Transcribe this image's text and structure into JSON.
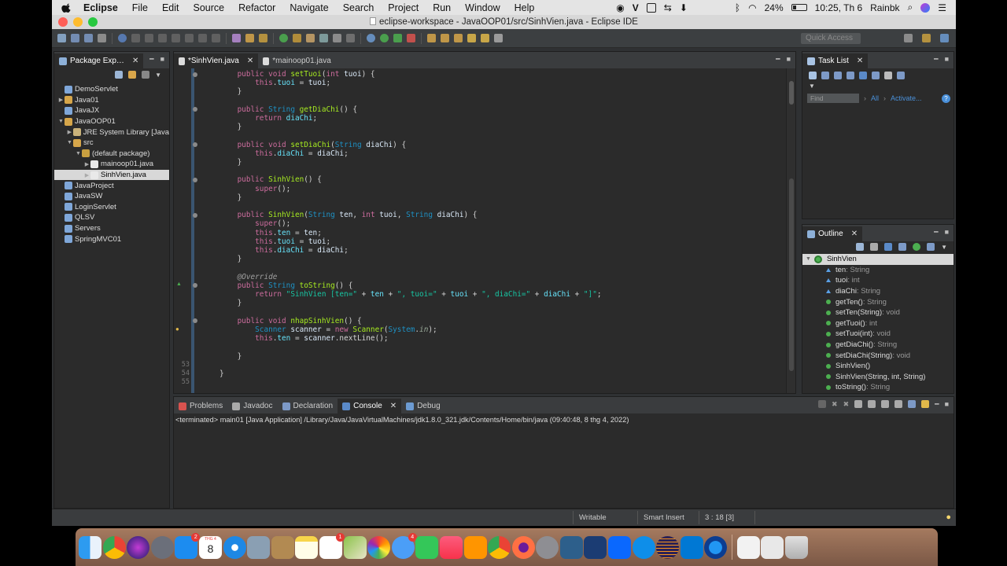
{
  "menubar": {
    "app_name": "Eclipse",
    "items": [
      "File",
      "Edit",
      "Source",
      "Refactor",
      "Navigate",
      "Search",
      "Project",
      "Run",
      "Window",
      "Help"
    ],
    "battery": "24%",
    "clock": "10:25, Th 6",
    "user": "Rainbk"
  },
  "window": {
    "title": "eclipse-workspace - JavaOOP01/src/SinhVien.java - Eclipse IDE"
  },
  "toolbar": {
    "quick_access_placeholder": "Quick Access"
  },
  "package_explorer": {
    "tab_label": "Package Exp…",
    "items": [
      {
        "label": "DemoServlet",
        "level": 0,
        "icon": "project-icon",
        "twisty": ""
      },
      {
        "label": "Java01",
        "level": 0,
        "icon": "java-project-icon",
        "twisty": "▶"
      },
      {
        "label": "JavaJX",
        "level": 0,
        "icon": "project-icon",
        "twisty": ""
      },
      {
        "label": "JavaOOP01",
        "level": 0,
        "icon": "java-project-icon",
        "twisty": "▼"
      },
      {
        "label": "JRE System Library [Java",
        "level": 1,
        "icon": "library-icon",
        "twisty": "▶"
      },
      {
        "label": "src",
        "level": 1,
        "icon": "source-folder-icon",
        "twisty": "▼"
      },
      {
        "label": "(default package)",
        "level": 2,
        "icon": "package-icon",
        "twisty": "▼"
      },
      {
        "label": "mainoop01.java",
        "level": 3,
        "icon": "java-file-icon",
        "twisty": "▶"
      },
      {
        "label": "SinhVien.java",
        "level": 3,
        "icon": "java-file-icon",
        "twisty": "▶",
        "selected": true
      },
      {
        "label": "JavaProject",
        "level": 0,
        "icon": "project-icon",
        "twisty": ""
      },
      {
        "label": "JavaSW",
        "level": 0,
        "icon": "project-icon",
        "twisty": ""
      },
      {
        "label": "LoginServlet",
        "level": 0,
        "icon": "project-icon",
        "twisty": ""
      },
      {
        "label": "QLSV",
        "level": 0,
        "icon": "project-icon",
        "twisty": ""
      },
      {
        "label": "Servers",
        "level": 0,
        "icon": "project-icon",
        "twisty": ""
      },
      {
        "label": "SpringMVC01",
        "level": 0,
        "icon": "project-icon",
        "twisty": ""
      }
    ]
  },
  "editor": {
    "tabs": [
      "*SinhVien.java",
      "*mainoop01.java"
    ],
    "visible_line_numbers": [
      "53",
      "54",
      "55"
    ],
    "lines": [
      [
        {
          "t": "    "
        },
        {
          "t": "public void ",
          "c": "kw"
        },
        {
          "t": "setTuoi",
          "c": "mth"
        },
        {
          "t": "("
        },
        {
          "t": "int ",
          "c": "kw"
        },
        {
          "t": "tuoi",
          "c": "pl"
        },
        {
          "t": ") {"
        }
      ],
      [
        {
          "t": "        "
        },
        {
          "t": "this",
          "c": "kw"
        },
        {
          "t": "."
        },
        {
          "t": "tuoi",
          "c": "fld"
        },
        {
          "t": " = "
        },
        {
          "t": "tuoi",
          "c": "pl"
        },
        {
          "t": ";"
        }
      ],
      [
        {
          "t": "    }"
        }
      ],
      [
        {
          "t": ""
        }
      ],
      [
        {
          "t": "    "
        },
        {
          "t": "public ",
          "c": "kw"
        },
        {
          "t": "String ",
          "c": "ty"
        },
        {
          "t": "getDiaChi",
          "c": "mth"
        },
        {
          "t": "() {"
        }
      ],
      [
        {
          "t": "        "
        },
        {
          "t": "return ",
          "c": "kw"
        },
        {
          "t": "diaChi",
          "c": "fld"
        },
        {
          "t": ";"
        }
      ],
      [
        {
          "t": "    }"
        }
      ],
      [
        {
          "t": ""
        }
      ],
      [
        {
          "t": "    "
        },
        {
          "t": "public void ",
          "c": "kw"
        },
        {
          "t": "setDiaChi",
          "c": "mth"
        },
        {
          "t": "("
        },
        {
          "t": "String ",
          "c": "ty"
        },
        {
          "t": "diaChi",
          "c": "pl"
        },
        {
          "t": ") {"
        }
      ],
      [
        {
          "t": "        "
        },
        {
          "t": "this",
          "c": "kw"
        },
        {
          "t": "."
        },
        {
          "t": "diaChi",
          "c": "fld"
        },
        {
          "t": " = "
        },
        {
          "t": "diaChi",
          "c": "pl"
        },
        {
          "t": ";"
        }
      ],
      [
        {
          "t": "    }"
        }
      ],
      [
        {
          "t": ""
        }
      ],
      [
        {
          "t": "    "
        },
        {
          "t": "public ",
          "c": "kw"
        },
        {
          "t": "SinhVien",
          "c": "mth"
        },
        {
          "t": "() {"
        }
      ],
      [
        {
          "t": "        "
        },
        {
          "t": "super",
          "c": "kw"
        },
        {
          "t": "();"
        }
      ],
      [
        {
          "t": "    }"
        }
      ],
      [
        {
          "t": ""
        }
      ],
      [
        {
          "t": "    "
        },
        {
          "t": "public ",
          "c": "kw"
        },
        {
          "t": "SinhVien",
          "c": "mth"
        },
        {
          "t": "("
        },
        {
          "t": "String ",
          "c": "ty"
        },
        {
          "t": "ten",
          "c": "pl"
        },
        {
          "t": ", "
        },
        {
          "t": "int ",
          "c": "kw"
        },
        {
          "t": "tuoi",
          "c": "pl"
        },
        {
          "t": ", "
        },
        {
          "t": "String ",
          "c": "ty"
        },
        {
          "t": "diaChi",
          "c": "pl"
        },
        {
          "t": ") {"
        }
      ],
      [
        {
          "t": "        "
        },
        {
          "t": "super",
          "c": "kw"
        },
        {
          "t": "();"
        }
      ],
      [
        {
          "t": "        "
        },
        {
          "t": "this",
          "c": "kw"
        },
        {
          "t": "."
        },
        {
          "t": "ten",
          "c": "fld"
        },
        {
          "t": " = "
        },
        {
          "t": "ten",
          "c": "pl"
        },
        {
          "t": ";"
        }
      ],
      [
        {
          "t": "        "
        },
        {
          "t": "this",
          "c": "kw"
        },
        {
          "t": "."
        },
        {
          "t": "tuoi",
          "c": "fld"
        },
        {
          "t": " = "
        },
        {
          "t": "tuoi",
          "c": "pl"
        },
        {
          "t": ";"
        }
      ],
      [
        {
          "t": "        "
        },
        {
          "t": "this",
          "c": "kw"
        },
        {
          "t": "."
        },
        {
          "t": "diaChi",
          "c": "fld"
        },
        {
          "t": " = "
        },
        {
          "t": "diaChi",
          "c": "pl"
        },
        {
          "t": ";"
        }
      ],
      [
        {
          "t": "    }"
        }
      ],
      [
        {
          "t": ""
        }
      ],
      [
        {
          "t": "    "
        },
        {
          "t": "@Override",
          "c": "ann"
        }
      ],
      [
        {
          "t": "    "
        },
        {
          "t": "public ",
          "c": "kw"
        },
        {
          "t": "String ",
          "c": "ty"
        },
        {
          "t": "toString",
          "c": "mth"
        },
        {
          "t": "() {"
        }
      ],
      [
        {
          "t": "        "
        },
        {
          "t": "return ",
          "c": "kw"
        },
        {
          "t": "\"SinhVien [ten=\"",
          "c": "str"
        },
        {
          "t": " + "
        },
        {
          "t": "ten",
          "c": "fld"
        },
        {
          "t": " + "
        },
        {
          "t": "\", tuoi=\"",
          "c": "str"
        },
        {
          "t": " + "
        },
        {
          "t": "tuoi",
          "c": "fld"
        },
        {
          "t": " + "
        },
        {
          "t": "\", diaChi=\"",
          "c": "str"
        },
        {
          "t": " + "
        },
        {
          "t": "diaChi",
          "c": "fld"
        },
        {
          "t": " + "
        },
        {
          "t": "\"]\"",
          "c": "str"
        },
        {
          "t": ";"
        }
      ],
      [
        {
          "t": "    }"
        }
      ],
      [
        {
          "t": ""
        }
      ],
      [
        {
          "t": "    "
        },
        {
          "t": "public void ",
          "c": "kw"
        },
        {
          "t": "nhapSinhVien",
          "c": "mth"
        },
        {
          "t": "() {"
        }
      ],
      [
        {
          "t": "        "
        },
        {
          "t": "Scanner ",
          "c": "ty"
        },
        {
          "t": "scanner",
          "c": "pl"
        },
        {
          "t": " = "
        },
        {
          "t": "new ",
          "c": "kw"
        },
        {
          "t": "Scanner",
          "c": "mth"
        },
        {
          "t": "("
        },
        {
          "t": "System",
          "c": "ty"
        },
        {
          "t": "."
        },
        {
          "t": "in",
          "c": "statics"
        },
        {
          "t": ");"
        }
      ],
      [
        {
          "t": "        "
        },
        {
          "t": "this",
          "c": "kw"
        },
        {
          "t": "."
        },
        {
          "t": "ten",
          "c": "fld"
        },
        {
          "t": " = "
        },
        {
          "t": "scanner",
          "c": "pl"
        },
        {
          "t": ".nextLine();"
        }
      ],
      [
        {
          "t": ""
        }
      ],
      [
        {
          "t": "    }"
        }
      ],
      [
        {
          "t": ""
        }
      ],
      [
        {
          "t": "}"
        }
      ],
      [
        {
          "t": ""
        }
      ]
    ]
  },
  "task_list": {
    "tab_label": "Task List",
    "find_placeholder": "Find",
    "all_label": "All",
    "activate_label": "Activate..."
  },
  "outline": {
    "tab_label": "Outline",
    "class_name": "SinhVien",
    "items": [
      {
        "name": "ten",
        "type": " : String",
        "kind": "field"
      },
      {
        "name": "tuoi",
        "type": " : int",
        "kind": "field"
      },
      {
        "name": "diaChi",
        "type": " : String",
        "kind": "field"
      },
      {
        "name": "getTen()",
        "type": " : String",
        "kind": "method"
      },
      {
        "name": "setTen(String)",
        "type": " : void",
        "kind": "method"
      },
      {
        "name": "getTuoi()",
        "type": " : int",
        "kind": "method"
      },
      {
        "name": "setTuoi(int)",
        "type": " : void",
        "kind": "method"
      },
      {
        "name": "getDiaChi()",
        "type": " : String",
        "kind": "method"
      },
      {
        "name": "setDiaChi(String)",
        "type": " : void",
        "kind": "method"
      },
      {
        "name": "SinhVien()",
        "type": "",
        "kind": "ctor"
      },
      {
        "name": "SinhVien(String, int, String)",
        "type": "",
        "kind": "ctor"
      },
      {
        "name": "toString()",
        "type": " : String",
        "kind": "method"
      }
    ]
  },
  "bottom_panel": {
    "tabs": [
      "Problems",
      "Javadoc",
      "Declaration",
      "Console",
      "Debug"
    ],
    "active_tab": "Console",
    "console_text": "<terminated> main01 [Java Application] /Library/Java/JavaVirtualMachines/jdk1.8.0_321.jdk/Contents/Home/bin/java (09:40:48, 8 thg 4, 2022)"
  },
  "status_bar": {
    "writable": "Writable",
    "insert_mode": "Smart Insert",
    "cursor_pos": "3 : 18 [3]"
  },
  "dock": {
    "calendar_month": "THG 4",
    "calendar_day": "8",
    "badges": {
      "appstore": "2",
      "mail": "1",
      "messages": "4"
    }
  },
  "colors": {
    "editor_bg": "#2b2b2b",
    "keyword": "#cc6c9d",
    "type": "#1e90c3",
    "field": "#66e1f8",
    "string": "#17c6a3",
    "method": "#a7ec21"
  }
}
